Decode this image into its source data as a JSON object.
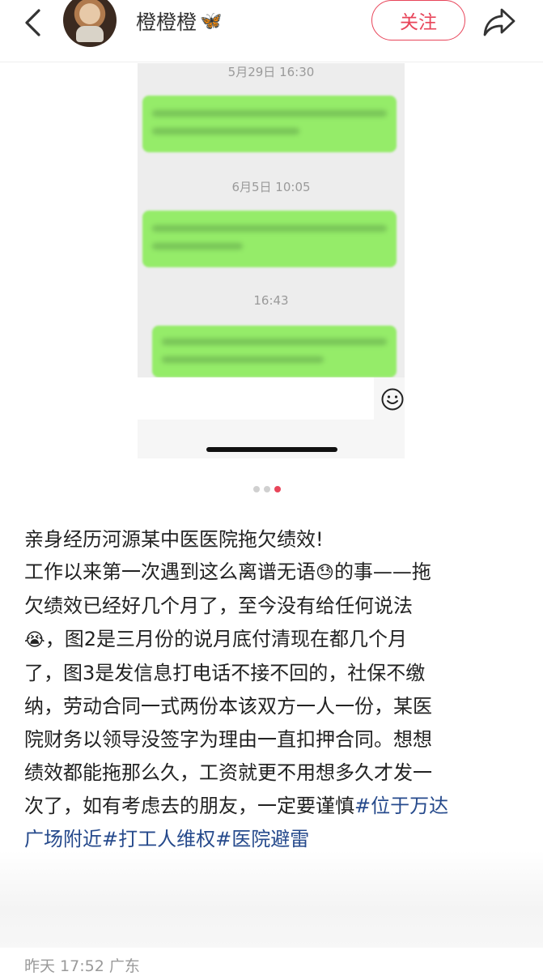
{
  "header": {
    "username": "橙橙橙",
    "username_badge": "🦋",
    "follow_label": "关注"
  },
  "photo": {
    "timestamps": [
      "5月29日 16:30",
      "6月5日 10:05",
      "16:43"
    ],
    "bubble_color": "#95ec69",
    "carousel_pages": 3,
    "carousel_active_index": 2
  },
  "post": {
    "title": "亲身经历河源某中医医院拖欠绩效!",
    "lines": [
      [
        "工作以来第一次遇到这么离谱无语",
        "😓",
        "的事——拖"
      ],
      [
        "欠绩效已经好几个月了，至今没有给任何说法"
      ],
      [
        "😭",
        "，图2是三月份的说月底付清现在都几个月"
      ],
      [
        "了，图3是发信息打电话不接不回的，社保不缴"
      ],
      [
        "纳，劳动合同一式两份本该双方一人一份，某医"
      ],
      [
        "院财务以领导没签字为理由一直扣押合同。想想"
      ],
      [
        "绩效都能拖那么久，工资就更不用想多久才发一"
      ],
      [
        "次了，如有考虑去的朋友，一定要谨慎"
      ]
    ],
    "tags": [
      "#位于万达",
      "广场附近",
      "#打工人维权",
      "#医院避雷"
    ],
    "tag_color": "#264a8c",
    "meta": "昨天 17:52 广东"
  },
  "accent_color": "#e8455a"
}
